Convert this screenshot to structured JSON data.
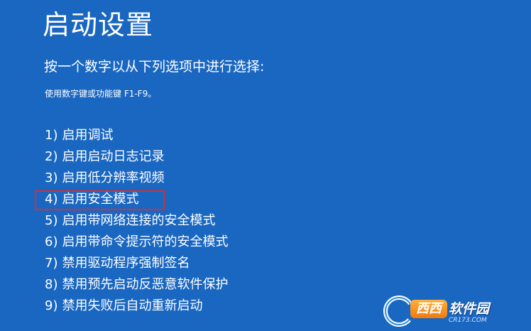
{
  "page": {
    "title": "启动设置",
    "instruction": "按一个数字以从下列选项中进行选择:",
    "hint": "使用数字键或功能键 F1-F9。",
    "background_color": "#1a67c2",
    "highlight_color": "#e02a2a"
  },
  "options": [
    {
      "num": "1)",
      "label": "启用调试"
    },
    {
      "num": "2)",
      "label": "启用启动日志记录"
    },
    {
      "num": "3)",
      "label": "启用低分辨率视频"
    },
    {
      "num": "4)",
      "label": "启用安全模式"
    },
    {
      "num": "5)",
      "label": "启用带网络连接的安全模式"
    },
    {
      "num": "6)",
      "label": "启用带命令提示符的安全模式"
    },
    {
      "num": "7)",
      "label": "禁用驱动程序强制签名"
    },
    {
      "num": "8)",
      "label": "禁用预先启动反恶意软件保护"
    },
    {
      "num": "9)",
      "label": "禁用失败后自动重新启动"
    }
  ],
  "highlighted_option": 4,
  "watermark": {
    "badge": "西西",
    "text": "软件园",
    "sub": "CR173.COM"
  }
}
